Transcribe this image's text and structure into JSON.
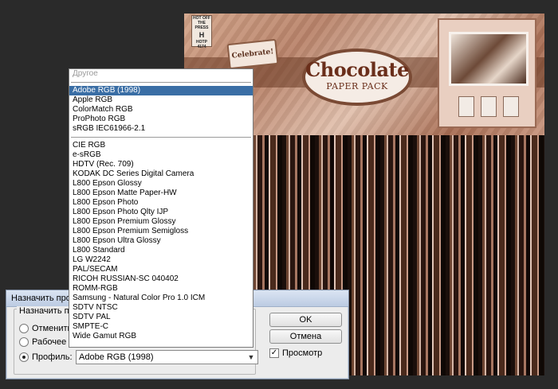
{
  "document": {
    "hot_off_press_text": "HOT OFF THE PRESS",
    "hot_off_press_code": "H",
    "hot_off_press_number": "HOTP 4174",
    "celebrate_text": "Celebrate!",
    "title_main": "Chocolate",
    "title_sub": "PAPER PACK"
  },
  "dialog": {
    "title": "Назначить профиль",
    "group_label": "Назначить п",
    "radio_dont_manage": "Отменить уп",
    "radio_working": "Рабочее пр",
    "radio_profile": "Профиль:",
    "selected_profile": "Adobe RGB (1998)",
    "ok_label": "OK",
    "cancel_label": "Отмена",
    "preview_label": "Просмотр",
    "preview_checked": true
  },
  "dropdown": {
    "header": "Другое",
    "group1": [
      "Adobe RGB (1998)",
      "Apple RGB",
      "ColorMatch RGB",
      "ProPhoto RGB",
      "sRGB IEC61966-2.1"
    ],
    "group2": [
      "CIE RGB",
      "e-sRGB",
      "HDTV (Rec. 709)",
      "KODAK DC Series Digital Camera",
      "L800 Epson Glossy",
      "L800 Epson Matte Paper-HW",
      "L800 Epson Photo",
      "L800 Epson Photo Qlty IJP",
      "L800 Epson Premium Glossy",
      "L800 Epson Premium Semigloss",
      "L800 Epson Ultra Glossy",
      "L800 Standard",
      "LG W2242",
      "PAL/SECAM",
      "RICOH RUSSIAN-SC 040402",
      "ROMM-RGB",
      "Samsung - Natural Color Pro 1.0 ICM",
      "SDTV NTSC",
      "SDTV PAL",
      "SMPTE-C",
      "Wide Gamut RGB"
    ],
    "selected": "Adobe RGB (1998)"
  },
  "colors": {
    "selection": "#3a6ea5",
    "workspace": "#2a2a2a"
  }
}
